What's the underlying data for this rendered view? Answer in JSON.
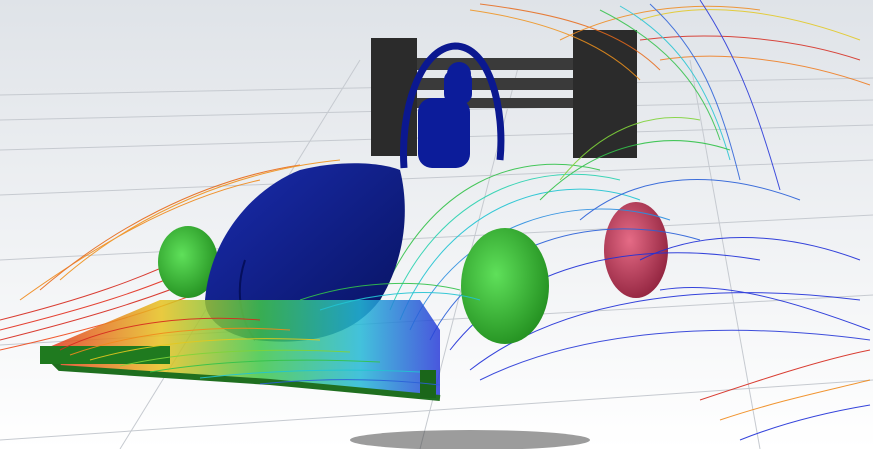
{
  "scene": {
    "palette": {
      "floor_top": "#dde1e6",
      "floor_bottom": "#ffffff",
      "grid": "#c8ccd2",
      "body": "#0a1a8a",
      "body_dark": "#050f5c",
      "tyre_front": "#2fae2a",
      "tyre_rear": "#c23b5a",
      "wing_plate": "#1f6f1f",
      "rear_wing": "#2a2a2a",
      "flow_red": "#d62a1e",
      "flow_orange": "#f08a1c",
      "flow_yellow": "#d8d823",
      "flow_green": "#33c24a",
      "flow_cyan": "#22c4d2",
      "flow_blue": "#2030d8"
    },
    "objects": [
      "rear-wing-icon",
      "roll-hoop-icon",
      "driver-helmet-icon",
      "chassis-body-icon",
      "front-tyre-left-icon",
      "front-tyre-right-icon",
      "rear-tyre-right-icon",
      "front-wing-icon",
      "streamlines-icon",
      "ground-shadow-icon"
    ]
  }
}
